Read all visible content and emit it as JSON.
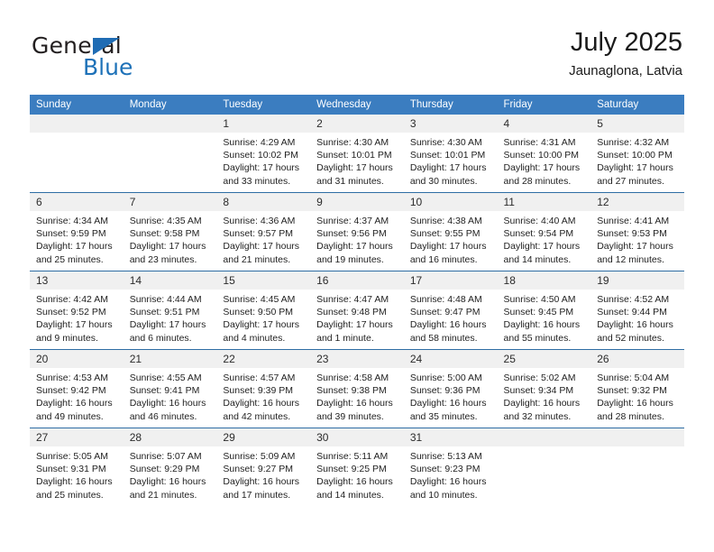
{
  "brand": {
    "name_part1": "General",
    "name_part2": "Blue",
    "triangle_color": "#1f6cb4"
  },
  "header": {
    "title": "July 2025",
    "subtitle": "Jaunaglona, Latvia",
    "accent_color": "#3b7dc0",
    "row_divider_color": "#2e6da4",
    "daynum_background": "#f0f0f0"
  },
  "weekdays": [
    "Sunday",
    "Monday",
    "Tuesday",
    "Wednesday",
    "Thursday",
    "Friday",
    "Saturday"
  ],
  "labels": {
    "sunrise_prefix": "Sunrise:",
    "sunset_prefix": "Sunset:",
    "daylight_prefix": "Daylight:"
  },
  "weeks": [
    [
      {
        "day": "",
        "empty": true
      },
      {
        "day": "",
        "empty": true
      },
      {
        "day": "1",
        "sunrise": "Sunrise: 4:29 AM",
        "sunset": "Sunset: 10:02 PM",
        "daylight_line1": "Daylight: 17 hours",
        "daylight_line2": "and 33 minutes."
      },
      {
        "day": "2",
        "sunrise": "Sunrise: 4:30 AM",
        "sunset": "Sunset: 10:01 PM",
        "daylight_line1": "Daylight: 17 hours",
        "daylight_line2": "and 31 minutes."
      },
      {
        "day": "3",
        "sunrise": "Sunrise: 4:30 AM",
        "sunset": "Sunset: 10:01 PM",
        "daylight_line1": "Daylight: 17 hours",
        "daylight_line2": "and 30 minutes."
      },
      {
        "day": "4",
        "sunrise": "Sunrise: 4:31 AM",
        "sunset": "Sunset: 10:00 PM",
        "daylight_line1": "Daylight: 17 hours",
        "daylight_line2": "and 28 minutes."
      },
      {
        "day": "5",
        "sunrise": "Sunrise: 4:32 AM",
        "sunset": "Sunset: 10:00 PM",
        "daylight_line1": "Daylight: 17 hours",
        "daylight_line2": "and 27 minutes."
      }
    ],
    [
      {
        "day": "6",
        "sunrise": "Sunrise: 4:34 AM",
        "sunset": "Sunset: 9:59 PM",
        "daylight_line1": "Daylight: 17 hours",
        "daylight_line2": "and 25 minutes."
      },
      {
        "day": "7",
        "sunrise": "Sunrise: 4:35 AM",
        "sunset": "Sunset: 9:58 PM",
        "daylight_line1": "Daylight: 17 hours",
        "daylight_line2": "and 23 minutes."
      },
      {
        "day": "8",
        "sunrise": "Sunrise: 4:36 AM",
        "sunset": "Sunset: 9:57 PM",
        "daylight_line1": "Daylight: 17 hours",
        "daylight_line2": "and 21 minutes."
      },
      {
        "day": "9",
        "sunrise": "Sunrise: 4:37 AM",
        "sunset": "Sunset: 9:56 PM",
        "daylight_line1": "Daylight: 17 hours",
        "daylight_line2": "and 19 minutes."
      },
      {
        "day": "10",
        "sunrise": "Sunrise: 4:38 AM",
        "sunset": "Sunset: 9:55 PM",
        "daylight_line1": "Daylight: 17 hours",
        "daylight_line2": "and 16 minutes."
      },
      {
        "day": "11",
        "sunrise": "Sunrise: 4:40 AM",
        "sunset": "Sunset: 9:54 PM",
        "daylight_line1": "Daylight: 17 hours",
        "daylight_line2": "and 14 minutes."
      },
      {
        "day": "12",
        "sunrise": "Sunrise: 4:41 AM",
        "sunset": "Sunset: 9:53 PM",
        "daylight_line1": "Daylight: 17 hours",
        "daylight_line2": "and 12 minutes."
      }
    ],
    [
      {
        "day": "13",
        "sunrise": "Sunrise: 4:42 AM",
        "sunset": "Sunset: 9:52 PM",
        "daylight_line1": "Daylight: 17 hours",
        "daylight_line2": "and 9 minutes."
      },
      {
        "day": "14",
        "sunrise": "Sunrise: 4:44 AM",
        "sunset": "Sunset: 9:51 PM",
        "daylight_line1": "Daylight: 17 hours",
        "daylight_line2": "and 6 minutes."
      },
      {
        "day": "15",
        "sunrise": "Sunrise: 4:45 AM",
        "sunset": "Sunset: 9:50 PM",
        "daylight_line1": "Daylight: 17 hours",
        "daylight_line2": "and 4 minutes."
      },
      {
        "day": "16",
        "sunrise": "Sunrise: 4:47 AM",
        "sunset": "Sunset: 9:48 PM",
        "daylight_line1": "Daylight: 17 hours",
        "daylight_line2": "and 1 minute."
      },
      {
        "day": "17",
        "sunrise": "Sunrise: 4:48 AM",
        "sunset": "Sunset: 9:47 PM",
        "daylight_line1": "Daylight: 16 hours",
        "daylight_line2": "and 58 minutes."
      },
      {
        "day": "18",
        "sunrise": "Sunrise: 4:50 AM",
        "sunset": "Sunset: 9:45 PM",
        "daylight_line1": "Daylight: 16 hours",
        "daylight_line2": "and 55 minutes."
      },
      {
        "day": "19",
        "sunrise": "Sunrise: 4:52 AM",
        "sunset": "Sunset: 9:44 PM",
        "daylight_line1": "Daylight: 16 hours",
        "daylight_line2": "and 52 minutes."
      }
    ],
    [
      {
        "day": "20",
        "sunrise": "Sunrise: 4:53 AM",
        "sunset": "Sunset: 9:42 PM",
        "daylight_line1": "Daylight: 16 hours",
        "daylight_line2": "and 49 minutes."
      },
      {
        "day": "21",
        "sunrise": "Sunrise: 4:55 AM",
        "sunset": "Sunset: 9:41 PM",
        "daylight_line1": "Daylight: 16 hours",
        "daylight_line2": "and 46 minutes."
      },
      {
        "day": "22",
        "sunrise": "Sunrise: 4:57 AM",
        "sunset": "Sunset: 9:39 PM",
        "daylight_line1": "Daylight: 16 hours",
        "daylight_line2": "and 42 minutes."
      },
      {
        "day": "23",
        "sunrise": "Sunrise: 4:58 AM",
        "sunset": "Sunset: 9:38 PM",
        "daylight_line1": "Daylight: 16 hours",
        "daylight_line2": "and 39 minutes."
      },
      {
        "day": "24",
        "sunrise": "Sunrise: 5:00 AM",
        "sunset": "Sunset: 9:36 PM",
        "daylight_line1": "Daylight: 16 hours",
        "daylight_line2": "and 35 minutes."
      },
      {
        "day": "25",
        "sunrise": "Sunrise: 5:02 AM",
        "sunset": "Sunset: 9:34 PM",
        "daylight_line1": "Daylight: 16 hours",
        "daylight_line2": "and 32 minutes."
      },
      {
        "day": "26",
        "sunrise": "Sunrise: 5:04 AM",
        "sunset": "Sunset: 9:32 PM",
        "daylight_line1": "Daylight: 16 hours",
        "daylight_line2": "and 28 minutes."
      }
    ],
    [
      {
        "day": "27",
        "sunrise": "Sunrise: 5:05 AM",
        "sunset": "Sunset: 9:31 PM",
        "daylight_line1": "Daylight: 16 hours",
        "daylight_line2": "and 25 minutes."
      },
      {
        "day": "28",
        "sunrise": "Sunrise: 5:07 AM",
        "sunset": "Sunset: 9:29 PM",
        "daylight_line1": "Daylight: 16 hours",
        "daylight_line2": "and 21 minutes."
      },
      {
        "day": "29",
        "sunrise": "Sunrise: 5:09 AM",
        "sunset": "Sunset: 9:27 PM",
        "daylight_line1": "Daylight: 16 hours",
        "daylight_line2": "and 17 minutes."
      },
      {
        "day": "30",
        "sunrise": "Sunrise: 5:11 AM",
        "sunset": "Sunset: 9:25 PM",
        "daylight_line1": "Daylight: 16 hours",
        "daylight_line2": "and 14 minutes."
      },
      {
        "day": "31",
        "sunrise": "Sunrise: 5:13 AM",
        "sunset": "Sunset: 9:23 PM",
        "daylight_line1": "Daylight: 16 hours",
        "daylight_line2": "and 10 minutes."
      },
      {
        "day": "",
        "empty": true
      },
      {
        "day": "",
        "empty": true
      }
    ]
  ]
}
